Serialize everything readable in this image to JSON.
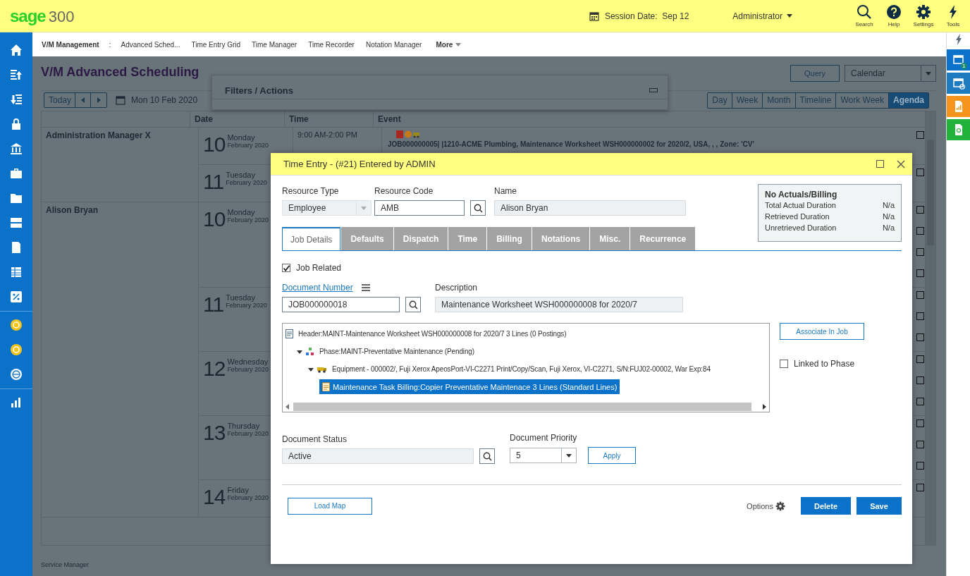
{
  "topbar": {
    "brand": "sage",
    "product": "300",
    "session_label": "Session Date:",
    "session_date": "Sep 12",
    "user": "Administrator",
    "tools": [
      {
        "kind": "search",
        "label": "Search"
      },
      {
        "kind": "help",
        "label": "Help"
      },
      {
        "kind": "settings",
        "label": "Settings"
      },
      {
        "kind": "tools",
        "label": "Tools"
      }
    ]
  },
  "nav": {
    "title": "V/M Management",
    "separator": ":",
    "items": [
      "Advanced Sched...",
      "Time Entry Grid",
      "Time Manager",
      "Time Recorder",
      "Notation Manager"
    ],
    "more": "More"
  },
  "rail": [
    {
      "kind": "window",
      "color": "#0a72c9",
      "badge": "1"
    },
    {
      "kind": "window-check",
      "color": "#1f7bbf"
    },
    {
      "kind": "report",
      "color": "#f7941d"
    },
    {
      "kind": "doc-search",
      "color": "#20b23a"
    }
  ],
  "page": {
    "title": "V/M Advanced Scheduling",
    "query": "Query",
    "view_select": "Calendar",
    "today": "Today",
    "date": "Mon 10 Feb 2020",
    "filters_title": "Filters / Actions",
    "views": [
      {
        "label": "Day",
        "selected": false
      },
      {
        "label": "Week",
        "selected": false
      },
      {
        "label": "Month",
        "selected": false
      },
      {
        "label": "Timeline",
        "selected": false
      },
      {
        "label": "Work Week",
        "selected": false
      },
      {
        "label": "Agenda",
        "selected": true
      }
    ]
  },
  "agenda": {
    "columns": [
      "Date",
      "Time",
      "Event"
    ],
    "groups": [
      {
        "resource": "Administration Manager X",
        "days": [
          {
            "day": "10",
            "weekday": "Monday",
            "month": "February 2020",
            "events": [
              {
                "time": "9:00 AM-2:00 PM",
                "text": "JOB000000005| |1210-ACME Plumbing, Maintenance Worksheet WSH000000002 for 2020/2, USA, , , Zone: 'CV'",
                "checked": false
              }
            ]
          },
          {
            "day": "11",
            "weekday": "Tuesday",
            "month": "February 2020",
            "events": [
              {
                "checked": false
              }
            ]
          }
        ]
      },
      {
        "resource": "Alison Bryan",
        "days": [
          {
            "day": "10",
            "weekday": "Monday",
            "month": "February 2020",
            "events": [
              {
                "checked": false
              },
              {
                "checked": false
              },
              {
                "checked": false
              },
              {
                "checked": false
              }
            ]
          },
          {
            "day": "11",
            "weekday": "Tuesday",
            "month": "February 2020",
            "events": [
              {
                "checked": false
              },
              {
                "checked": false
              },
              {
                "checked": false
              }
            ]
          },
          {
            "day": "12",
            "weekday": "Wednesday",
            "month": "February 2020",
            "events": [
              {
                "checked": false
              },
              {
                "checked": false
              },
              {
                "checked": false
              }
            ]
          },
          {
            "day": "13",
            "weekday": "Thursday",
            "month": "February 2020",
            "events": [
              {
                "checked": false
              },
              {
                "checked": false
              },
              {
                "checked": false
              }
            ]
          },
          {
            "day": "14",
            "weekday": "Friday",
            "month": "February 2020",
            "events": [
              {
                "checked": false
              }
            ]
          }
        ]
      }
    ]
  },
  "footer": "Service Manager",
  "dialog": {
    "title": "Time Entry - (#21) Entered by ADMIN",
    "resource_type": {
      "label": "Resource Type",
      "value": "Employee"
    },
    "resource_code": {
      "label": "Resource Code",
      "value": "AMB"
    },
    "name": {
      "label": "Name",
      "value": "Alison Bryan"
    },
    "summary": {
      "title": "No Actuals/Billing",
      "rows": [
        {
          "label": "Total Actual Duration",
          "value": "N/a"
        },
        {
          "label": "Retrieved Duration",
          "value": "N/a"
        },
        {
          "label": "Unretrieved Duration",
          "value": "N/a"
        }
      ]
    },
    "tabs": [
      {
        "label": "Job Details",
        "selected": true
      },
      {
        "label": "Defaults",
        "selected": false
      },
      {
        "label": "Dispatch",
        "selected": false
      },
      {
        "label": "Time",
        "selected": false
      },
      {
        "label": "Billing",
        "selected": false
      },
      {
        "label": "Notations",
        "selected": false
      },
      {
        "label": "Misc.",
        "selected": false
      },
      {
        "label": "Recurrence",
        "selected": false
      }
    ],
    "job_related": {
      "label": "Job Related",
      "checked": true
    },
    "document_number": {
      "label": "Document Number",
      "value": "JOB000000018"
    },
    "description": {
      "label": "Description",
      "value": "Maintenance Worksheet WSH000000008 for 2020/7"
    },
    "tree": [
      {
        "kind": "header",
        "text": "Header:MAINT-Maintenance Worksheet WSH000000008 for 2020/7 3 Lines (0 Postings)",
        "selected": false,
        "children": [
          {
            "kind": "phase",
            "text": "Phase:MAINT-Preventative Maintenance (Pending)",
            "expanded": true,
            "selected": false,
            "children": [
              {
                "kind": "equipment",
                "text": "Equipment - 000002/, Fuji Xerox ApeosPort-VI-C2271 Print/Copy/Scan, Fuji Xerox, VI-C2271, S/N:FUJ02-00002, War Exp:84",
                "expanded": true,
                "selected": false,
                "children": [
                  {
                    "kind": "task",
                    "text": "Maintenance Task Billing:Copier Preventative Maintenace 3 Lines (Standard Lines)",
                    "selected": true
                  }
                ]
              }
            ]
          }
        ]
      }
    ],
    "associate": "Associate In Job",
    "linked": {
      "label": "Linked to Phase",
      "checked": false
    },
    "status": {
      "label": "Document Status",
      "value": "Active"
    },
    "priority": {
      "label": "Document Priority",
      "value": "5"
    },
    "apply": "Apply",
    "load_map": "Load Map",
    "options": "Options",
    "delete": "Delete",
    "save": "Save"
  }
}
